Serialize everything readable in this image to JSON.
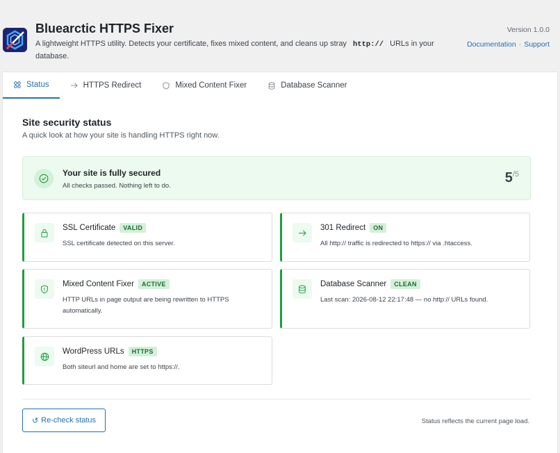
{
  "header": {
    "title": "Bluearctic HTTPS Fixer",
    "desc_before": "A lightweight HTTPS utility. Detects your certificate, fixes mixed content, and cleans up stray",
    "desc_code": "http://",
    "desc_after": "URLs in your database.",
    "version": "Version 1.0.0",
    "doc_link": "Documentation",
    "link_sep": "·",
    "support_link": "Support"
  },
  "tabs": [
    {
      "label": "Status",
      "icon": "grid-icon"
    },
    {
      "label": "HTTPS Redirect",
      "icon": "arrow-right-icon"
    },
    {
      "label": "Mixed Content Fixer",
      "icon": "shield-icon"
    },
    {
      "label": "Database Scanner",
      "icon": "database-icon"
    }
  ],
  "section": {
    "title": "Site security status",
    "subtitle": "A quick look at how your site is handling HTTPS right now."
  },
  "banner": {
    "title": "Your site is fully secured",
    "subtitle": "All checks passed. Nothing left to do.",
    "score": "5",
    "score_total": "/5"
  },
  "cards": [
    {
      "title": "SSL Certificate",
      "badge": "VALID",
      "desc": "SSL certificate detected on this server.",
      "icon": "lock-icon"
    },
    {
      "title": "301 Redirect",
      "badge": "ON",
      "desc": "All http:// traffic is redirected to https:// via .htaccess.",
      "icon": "arrow-right-icon"
    },
    {
      "title": "Mixed Content Fixer",
      "badge": "ACTIVE",
      "desc": "HTTP URLs in page output are being rewritten to HTTPS automatically.",
      "icon": "shield-icon"
    },
    {
      "title": "Database Scanner",
      "badge": "CLEAN",
      "desc": "Last scan: 2026-08-12 22:17:48 — no http:// URLs found.",
      "icon": "database-icon"
    },
    {
      "title": "WordPress URLs",
      "badge": "HTTPS",
      "desc": "Both siteurl and home are set to https://.",
      "icon": "globe-icon"
    }
  ],
  "footer": {
    "button": "Re-check status",
    "button_glyph": "↺",
    "note": "Status reflects the current page load."
  },
  "colors": {
    "accent": "#2271b1",
    "success": "#1e9e3c",
    "success_bg": "#edfaef"
  }
}
